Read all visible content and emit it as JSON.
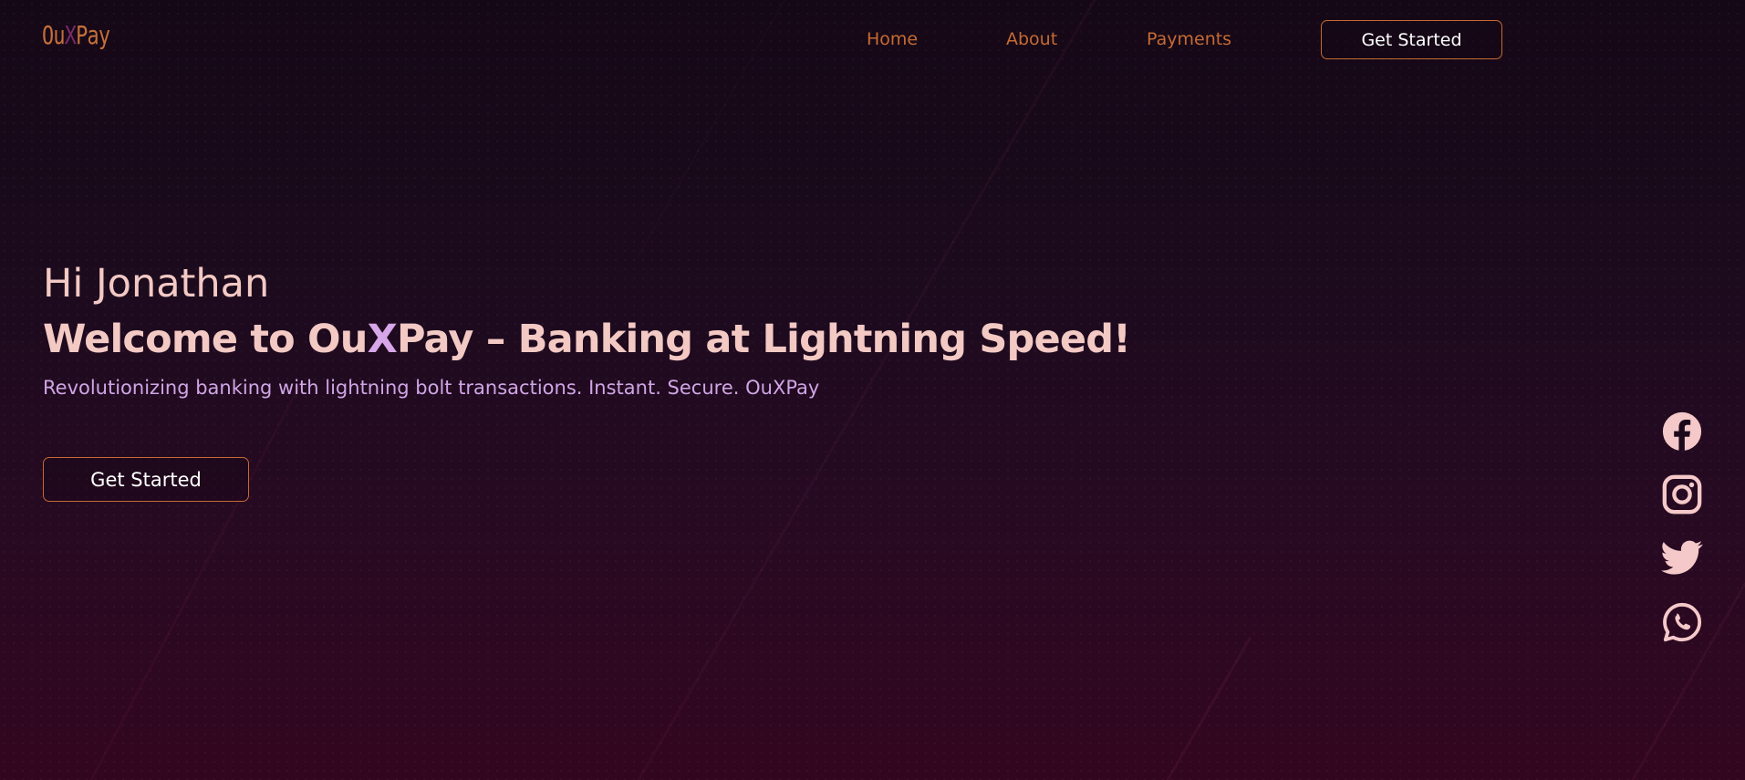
{
  "brand": {
    "logo_part1": "Ou",
    "logo_x": "X",
    "logo_part2": "Pay"
  },
  "nav": {
    "items": [
      {
        "label": "Home"
      },
      {
        "label": "About"
      },
      {
        "label": "Payments"
      }
    ],
    "cta_label": "Get Started"
  },
  "hero": {
    "greeting": "Hi Jonathan",
    "headline_before": "Welcome to Ou",
    "headline_x": "X",
    "headline_after": "Pay – Banking at Lightning Speed!",
    "tagline": "Revolutionizing banking with lightning bolt transactions. Instant. Secure. OuXPay",
    "cta_label": "Get Started"
  },
  "social": [
    {
      "icon": "facebook-icon"
    },
    {
      "icon": "instagram-icon"
    },
    {
      "icon": "twitter-icon"
    },
    {
      "icon": "whatsapp-icon"
    }
  ],
  "colors": {
    "accent": "#c56a33",
    "heading": "#f3c9c4",
    "subtle_purple": "#d0a5e6",
    "logo_x": "#7a2a68",
    "icon": "#f5c9c9"
  }
}
